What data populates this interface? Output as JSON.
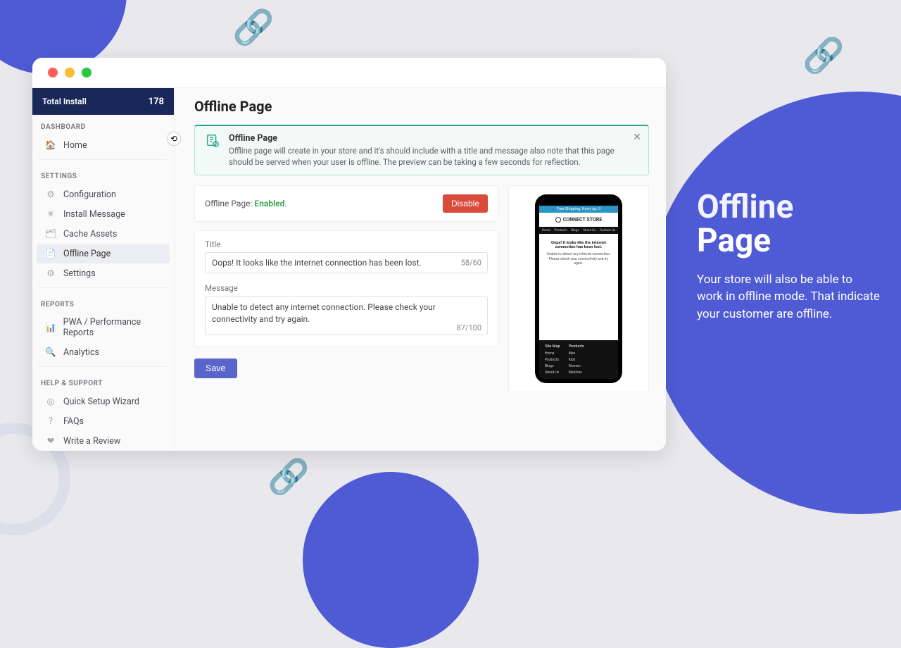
{
  "sidebar": {
    "install_label": "Total Install",
    "install_count": "178",
    "sections": {
      "dashboard": "DASHBOARD",
      "settings": "SETTINGS",
      "reports": "REPORTS",
      "help": "HELP & SUPPORT"
    },
    "items": {
      "home": "Home",
      "configuration": "Configuration",
      "install_message": "Install Message",
      "cache_assets": "Cache Assets",
      "offline_page": "Offline Page",
      "settings": "Settings",
      "pwa_reports": "PWA / Performance Reports",
      "analytics": "Analytics",
      "quick_setup": "Quick Setup Wizard",
      "faqs": "FAQs",
      "write_review": "Write a Review"
    }
  },
  "page": {
    "title": "Offline Page",
    "info": {
      "title": "Offline Page",
      "desc": "Offline page will create in your store and it's should include with a title and message also note that this page should be served when your user is offline. The preview can be taking a few seconds for reflection."
    },
    "status_prefix": "Offline Page:",
    "status_value": "Enabled",
    "disable_btn": "Disable",
    "title_label": "Title",
    "title_value": "Oops! It looks like the internet connection has been lost.",
    "title_counter": "58/60",
    "message_label": "Message",
    "message_value": "Unable to detect any internet connection. Please check your connectivity and try again.",
    "message_counter": "87/100",
    "save_btn": "Save"
  },
  "preview": {
    "banner": "Free Shipping, Hurry up..!!",
    "store": "CONNECT STORE",
    "nav": [
      "Home",
      "Products",
      "Blogs",
      "About Us",
      "Contact Us"
    ],
    "title": "Oops! It looks like the internet connection has been lost.",
    "msg": "Unable to detect any internet connection. Please check your connectivity and try again.",
    "footer": {
      "c1h": "Site Map",
      "c1": [
        "Home",
        "Products",
        "Blogs",
        "About Us"
      ],
      "c2h": "Products",
      "c2": [
        "Men",
        "Kids",
        "Women",
        "Watches"
      ]
    }
  },
  "promo": {
    "h1a": "Offline",
    "h1b": "Page",
    "body": "Your store will also be able to work in offline mode. That indicate your customer are offline."
  }
}
